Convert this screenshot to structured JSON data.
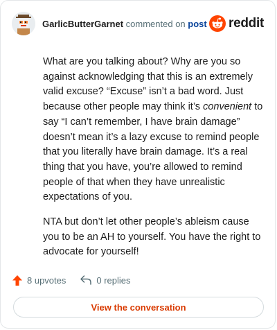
{
  "header": {
    "username": "GarlicButterGarnet",
    "action": "commented on",
    "post_link": "post",
    "brand": "reddit"
  },
  "comment": {
    "p1_a": "What are you talking about? Why are you so against acknowledging that this is an extremely valid excuse? “Excuse” isn’t a bad word. Just because other people may think it’s ",
    "p1_em": "convenient",
    "p1_b": " to say “I can’t remember, I have brain damage” doesn’t mean it’s a lazy excuse to remind people that you literally have brain damage. It’s a real thing that you have, you’re allowed to remind people of that when they have unrealistic expectations of you.",
    "p2": "NTA but don’t let other people’s ableism cause you to be an AH to yourself. You have the right to advocate for yourself!"
  },
  "footer": {
    "upvotes": "8 upvotes",
    "replies": "0 replies",
    "cta": "View the conversation"
  },
  "colors": {
    "brand": "#ff4500",
    "link": "#0a449b",
    "cta": "#d93a00"
  },
  "icons": [
    "avatar-icon",
    "reddit-logo-icon",
    "upvote-arrow-icon",
    "reply-arrow-icon"
  ]
}
